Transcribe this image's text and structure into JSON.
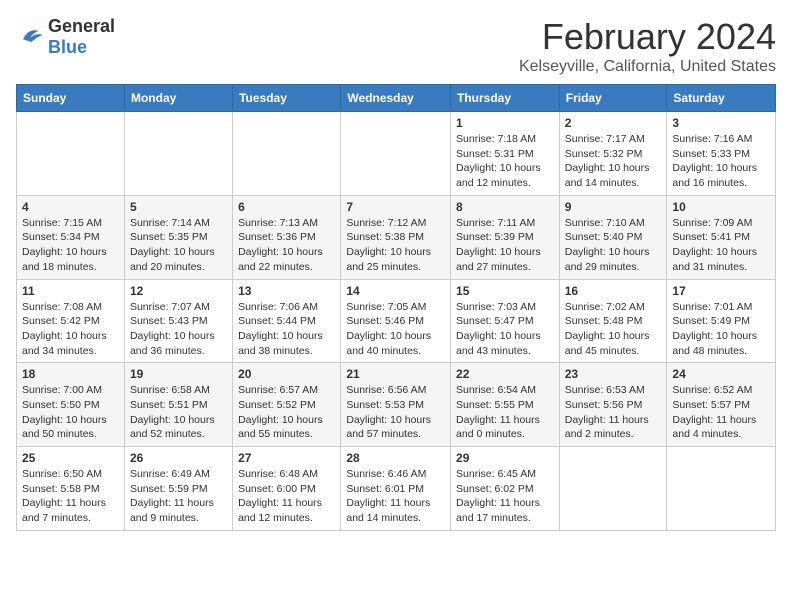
{
  "logo": {
    "general": "General",
    "blue": "Blue"
  },
  "title": "February 2024",
  "subtitle": "Kelseyville, California, United States",
  "days_of_week": [
    "Sunday",
    "Monday",
    "Tuesday",
    "Wednesday",
    "Thursday",
    "Friday",
    "Saturday"
  ],
  "weeks": [
    [
      {
        "day": "",
        "info": ""
      },
      {
        "day": "",
        "info": ""
      },
      {
        "day": "",
        "info": ""
      },
      {
        "day": "",
        "info": ""
      },
      {
        "day": "1",
        "info": "Sunrise: 7:18 AM\nSunset: 5:31 PM\nDaylight: 10 hours\nand 12 minutes."
      },
      {
        "day": "2",
        "info": "Sunrise: 7:17 AM\nSunset: 5:32 PM\nDaylight: 10 hours\nand 14 minutes."
      },
      {
        "day": "3",
        "info": "Sunrise: 7:16 AM\nSunset: 5:33 PM\nDaylight: 10 hours\nand 16 minutes."
      }
    ],
    [
      {
        "day": "4",
        "info": "Sunrise: 7:15 AM\nSunset: 5:34 PM\nDaylight: 10 hours\nand 18 minutes."
      },
      {
        "day": "5",
        "info": "Sunrise: 7:14 AM\nSunset: 5:35 PM\nDaylight: 10 hours\nand 20 minutes."
      },
      {
        "day": "6",
        "info": "Sunrise: 7:13 AM\nSunset: 5:36 PM\nDaylight: 10 hours\nand 22 minutes."
      },
      {
        "day": "7",
        "info": "Sunrise: 7:12 AM\nSunset: 5:38 PM\nDaylight: 10 hours\nand 25 minutes."
      },
      {
        "day": "8",
        "info": "Sunrise: 7:11 AM\nSunset: 5:39 PM\nDaylight: 10 hours\nand 27 minutes."
      },
      {
        "day": "9",
        "info": "Sunrise: 7:10 AM\nSunset: 5:40 PM\nDaylight: 10 hours\nand 29 minutes."
      },
      {
        "day": "10",
        "info": "Sunrise: 7:09 AM\nSunset: 5:41 PM\nDaylight: 10 hours\nand 31 minutes."
      }
    ],
    [
      {
        "day": "11",
        "info": "Sunrise: 7:08 AM\nSunset: 5:42 PM\nDaylight: 10 hours\nand 34 minutes."
      },
      {
        "day": "12",
        "info": "Sunrise: 7:07 AM\nSunset: 5:43 PM\nDaylight: 10 hours\nand 36 minutes."
      },
      {
        "day": "13",
        "info": "Sunrise: 7:06 AM\nSunset: 5:44 PM\nDaylight: 10 hours\nand 38 minutes."
      },
      {
        "day": "14",
        "info": "Sunrise: 7:05 AM\nSunset: 5:46 PM\nDaylight: 10 hours\nand 40 minutes."
      },
      {
        "day": "15",
        "info": "Sunrise: 7:03 AM\nSunset: 5:47 PM\nDaylight: 10 hours\nand 43 minutes."
      },
      {
        "day": "16",
        "info": "Sunrise: 7:02 AM\nSunset: 5:48 PM\nDaylight: 10 hours\nand 45 minutes."
      },
      {
        "day": "17",
        "info": "Sunrise: 7:01 AM\nSunset: 5:49 PM\nDaylight: 10 hours\nand 48 minutes."
      }
    ],
    [
      {
        "day": "18",
        "info": "Sunrise: 7:00 AM\nSunset: 5:50 PM\nDaylight: 10 hours\nand 50 minutes."
      },
      {
        "day": "19",
        "info": "Sunrise: 6:58 AM\nSunset: 5:51 PM\nDaylight: 10 hours\nand 52 minutes."
      },
      {
        "day": "20",
        "info": "Sunrise: 6:57 AM\nSunset: 5:52 PM\nDaylight: 10 hours\nand 55 minutes."
      },
      {
        "day": "21",
        "info": "Sunrise: 6:56 AM\nSunset: 5:53 PM\nDaylight: 10 hours\nand 57 minutes."
      },
      {
        "day": "22",
        "info": "Sunrise: 6:54 AM\nSunset: 5:55 PM\nDaylight: 11 hours\nand 0 minutes."
      },
      {
        "day": "23",
        "info": "Sunrise: 6:53 AM\nSunset: 5:56 PM\nDaylight: 11 hours\nand 2 minutes."
      },
      {
        "day": "24",
        "info": "Sunrise: 6:52 AM\nSunset: 5:57 PM\nDaylight: 11 hours\nand 4 minutes."
      }
    ],
    [
      {
        "day": "25",
        "info": "Sunrise: 6:50 AM\nSunset: 5:58 PM\nDaylight: 11 hours\nand 7 minutes."
      },
      {
        "day": "26",
        "info": "Sunrise: 6:49 AM\nSunset: 5:59 PM\nDaylight: 11 hours\nand 9 minutes."
      },
      {
        "day": "27",
        "info": "Sunrise: 6:48 AM\nSunset: 6:00 PM\nDaylight: 11 hours\nand 12 minutes."
      },
      {
        "day": "28",
        "info": "Sunrise: 6:46 AM\nSunset: 6:01 PM\nDaylight: 11 hours\nand 14 minutes."
      },
      {
        "day": "29",
        "info": "Sunrise: 6:45 AM\nSunset: 6:02 PM\nDaylight: 11 hours\nand 17 minutes."
      },
      {
        "day": "",
        "info": ""
      },
      {
        "day": "",
        "info": ""
      }
    ]
  ]
}
